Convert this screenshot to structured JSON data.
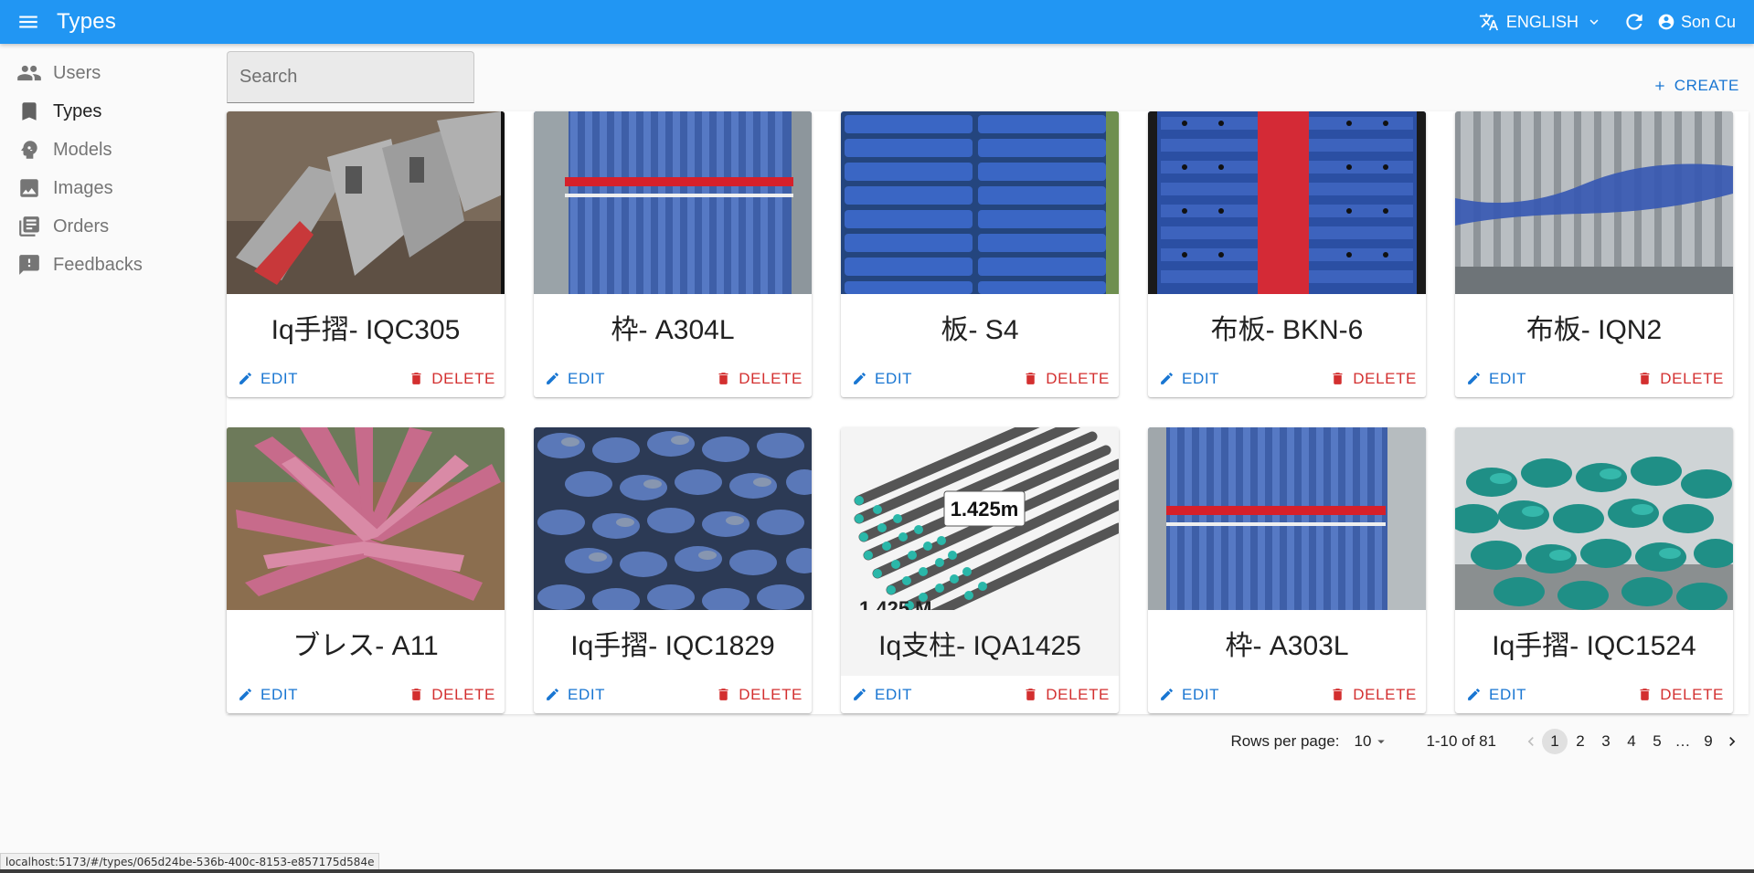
{
  "appbar": {
    "title": "Types",
    "language": "ENGLISH",
    "user": "Son Cu",
    "brand_color": "#2196f3"
  },
  "sidebar": {
    "items": [
      {
        "label": "Users",
        "icon": "people-icon"
      },
      {
        "label": "Types",
        "icon": "bookmark-icon"
      },
      {
        "label": "Models",
        "icon": "psychology-icon"
      },
      {
        "label": "Images",
        "icon": "image-icon"
      },
      {
        "label": "Orders",
        "icon": "list-alt-icon"
      },
      {
        "label": "Feedbacks",
        "icon": "feedback-icon"
      }
    ],
    "active": "Types"
  },
  "search": {
    "placeholder": "Search",
    "value": ""
  },
  "create_label": "CREATE",
  "card_actions": {
    "edit": "EDIT",
    "delete": "DELETE"
  },
  "cards": [
    {
      "name": "Iq手摺- IQC305"
    },
    {
      "name": "枠- A304L"
    },
    {
      "name": "板- S4"
    },
    {
      "name": "布板- BKN-6"
    },
    {
      "name": "布板- IQN2"
    },
    {
      "name": "ブレス- A11"
    },
    {
      "name": "Iq手摺- IQC1829"
    },
    {
      "name": "Iq支柱- IQA1425",
      "photo_labels": [
        "1.425m",
        "1.425 M"
      ]
    },
    {
      "name": "枠- A303L"
    },
    {
      "name": "Iq手摺- IQC1524"
    }
  ],
  "pagination": {
    "rows_per_page_label": "Rows per page:",
    "rows_per_page": "10",
    "range": "1-10 of 81",
    "pages": [
      "1",
      "2",
      "3",
      "4",
      "5"
    ],
    "ellipsis": "…",
    "last_page": "9",
    "current_page": "1"
  },
  "status_link": "localhost:5173/#/types/065d24be-536b-400c-8153-e857175d584e",
  "colors": {
    "primary": "#1976d2",
    "danger": "#d32f2f"
  }
}
